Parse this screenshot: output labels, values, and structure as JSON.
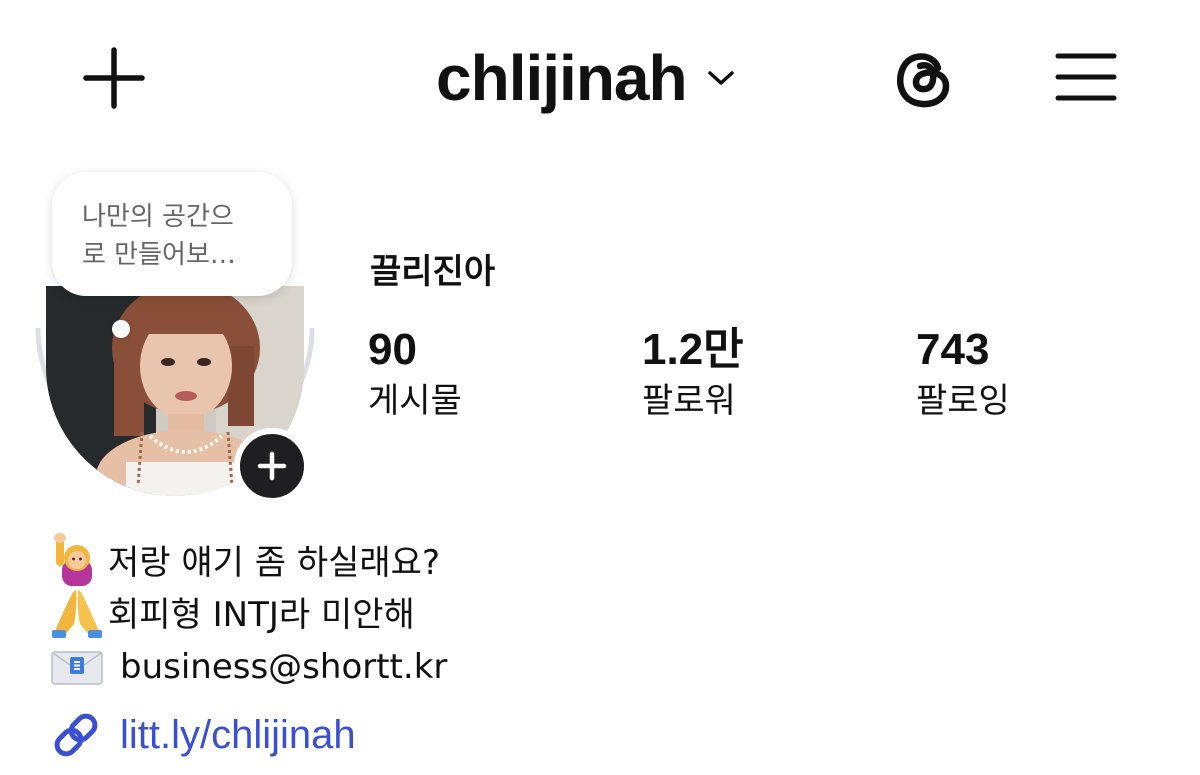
{
  "header": {
    "username": "chlijinah"
  },
  "profile": {
    "note": "나만의 공간으\n로 만들어보…",
    "display_name": "끌리진아",
    "stats": {
      "posts": {
        "count": "90",
        "label": "게시물"
      },
      "followers": {
        "count": "1.2만",
        "label": "팔로워"
      },
      "following": {
        "count": "743",
        "label": "팔로잉"
      }
    }
  },
  "bio": {
    "line1": "저랑 얘기 좀 하실래요?",
    "line2": "회피형 INTJ라 미안해",
    "line3": "business@shortt.kr",
    "link": "litt.ly/chlijinah"
  },
  "icons": {
    "create": "plus-icon",
    "threads": "threads-icon",
    "menu": "hamburger-menu-icon",
    "dropdown": "chevron-down-icon",
    "add_story": "plus-icon",
    "link": "link-icon"
  },
  "colors": {
    "link": "#3b4fd1",
    "add_story_bg": "#1f1f22",
    "avatar_ring": "#dcdee6"
  }
}
